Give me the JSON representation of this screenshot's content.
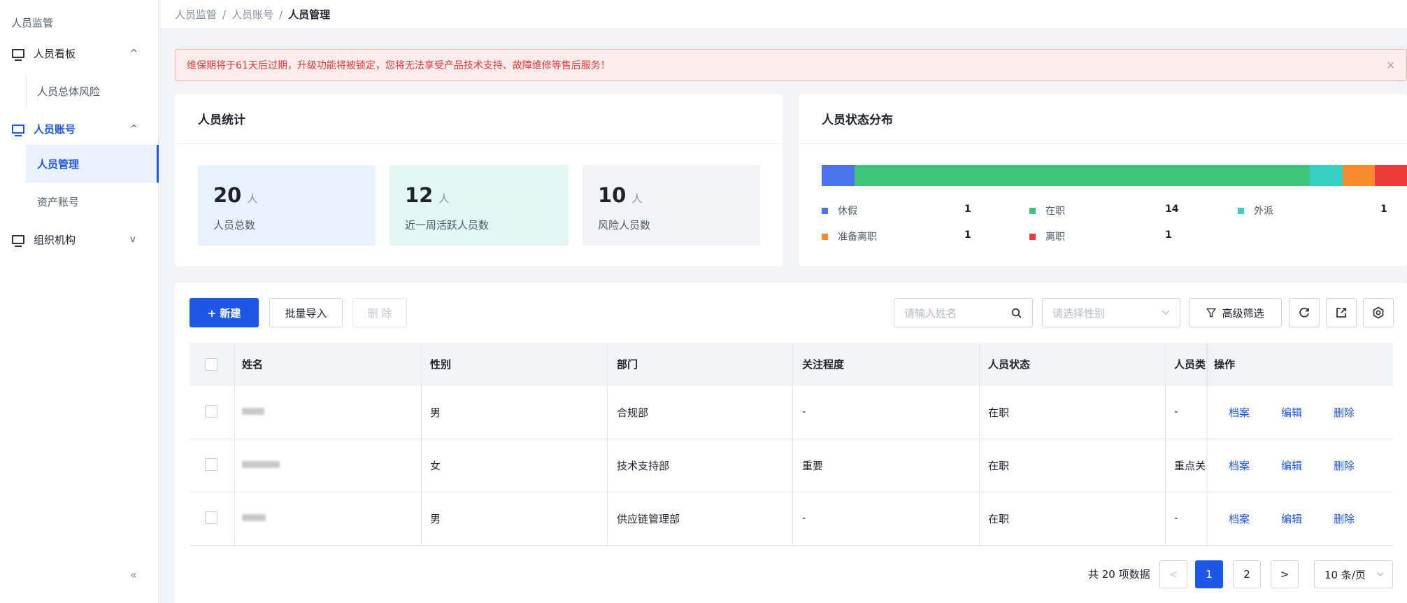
{
  "sidebar": {
    "title": "人员监管",
    "groups": [
      {
        "label": "人员看板",
        "chevron": "^"
      },
      {
        "label": "人员账号",
        "chevron": "^"
      },
      {
        "label": "组织机构",
        "chevron": "v"
      }
    ],
    "sub_items": [
      "人员总体风险",
      "人员管理",
      "资产账号"
    ],
    "collapse": "«"
  },
  "breadcrumb": [
    "人员监管",
    "人员账号",
    "人员管理"
  ],
  "breadcrumb_sep": "/",
  "alert": {
    "message": "维保期将于61天后过期，升级功能将被锁定，您将无法享受产品技术支持、故障维修等售后服务！",
    "close": "×"
  },
  "stats_card": {
    "title": "人员统计",
    "items": [
      {
        "value": "20",
        "unit": "人",
        "caption": "人员总数",
        "bg": "#e8f1fe"
      },
      {
        "value": "12",
        "unit": "人",
        "caption": "近一周活跃人员数",
        "bg": "#e3f7f3"
      },
      {
        "value": "10",
        "unit": "人",
        "caption": "风险人员数",
        "bg": "#f2f3f5"
      }
    ]
  },
  "status_card": {
    "title": "人员状态分布",
    "segments": [
      {
        "name": "休假",
        "value": 1,
        "color": "#4a74ee"
      },
      {
        "name": "在职",
        "value": 14,
        "color": "#3ec47a"
      },
      {
        "name": "外派",
        "value": 1,
        "color": "#35cfc4"
      },
      {
        "name": "准备离职",
        "value": 1,
        "color": "#fb8a2e"
      },
      {
        "name": "离职",
        "value": 1,
        "color": "#ef3a3a"
      }
    ]
  },
  "toolbar": {
    "new_label": "+ 新建",
    "import_label": "批量导入",
    "delete_label": "删 除",
    "search_placeholder": "请输入姓名",
    "gender_placeholder": "请选择性别",
    "advanced_label": "高级筛选"
  },
  "table": {
    "columns": [
      "姓名",
      "性别",
      "部门",
      "关注程度",
      "人员状态",
      "人员类",
      "操作"
    ],
    "rows": [
      {
        "gender": "男",
        "dept": "合规部",
        "attention": "-",
        "status": "在职",
        "type": "-"
      },
      {
        "gender": "女",
        "dept": "技术支持部",
        "attention": "重要",
        "status": "在职",
        "type": "重点关"
      },
      {
        "gender": "男",
        "dept": "供应链管理部",
        "attention": "-",
        "status": "在职",
        "type": "-"
      }
    ],
    "actions": [
      "档案",
      "编辑",
      "删除"
    ]
  },
  "pagination": {
    "total_text": "共 20 项数据",
    "prev": "<",
    "pages": [
      "1",
      "2"
    ],
    "next": ">",
    "page_size": "10 条/页"
  }
}
